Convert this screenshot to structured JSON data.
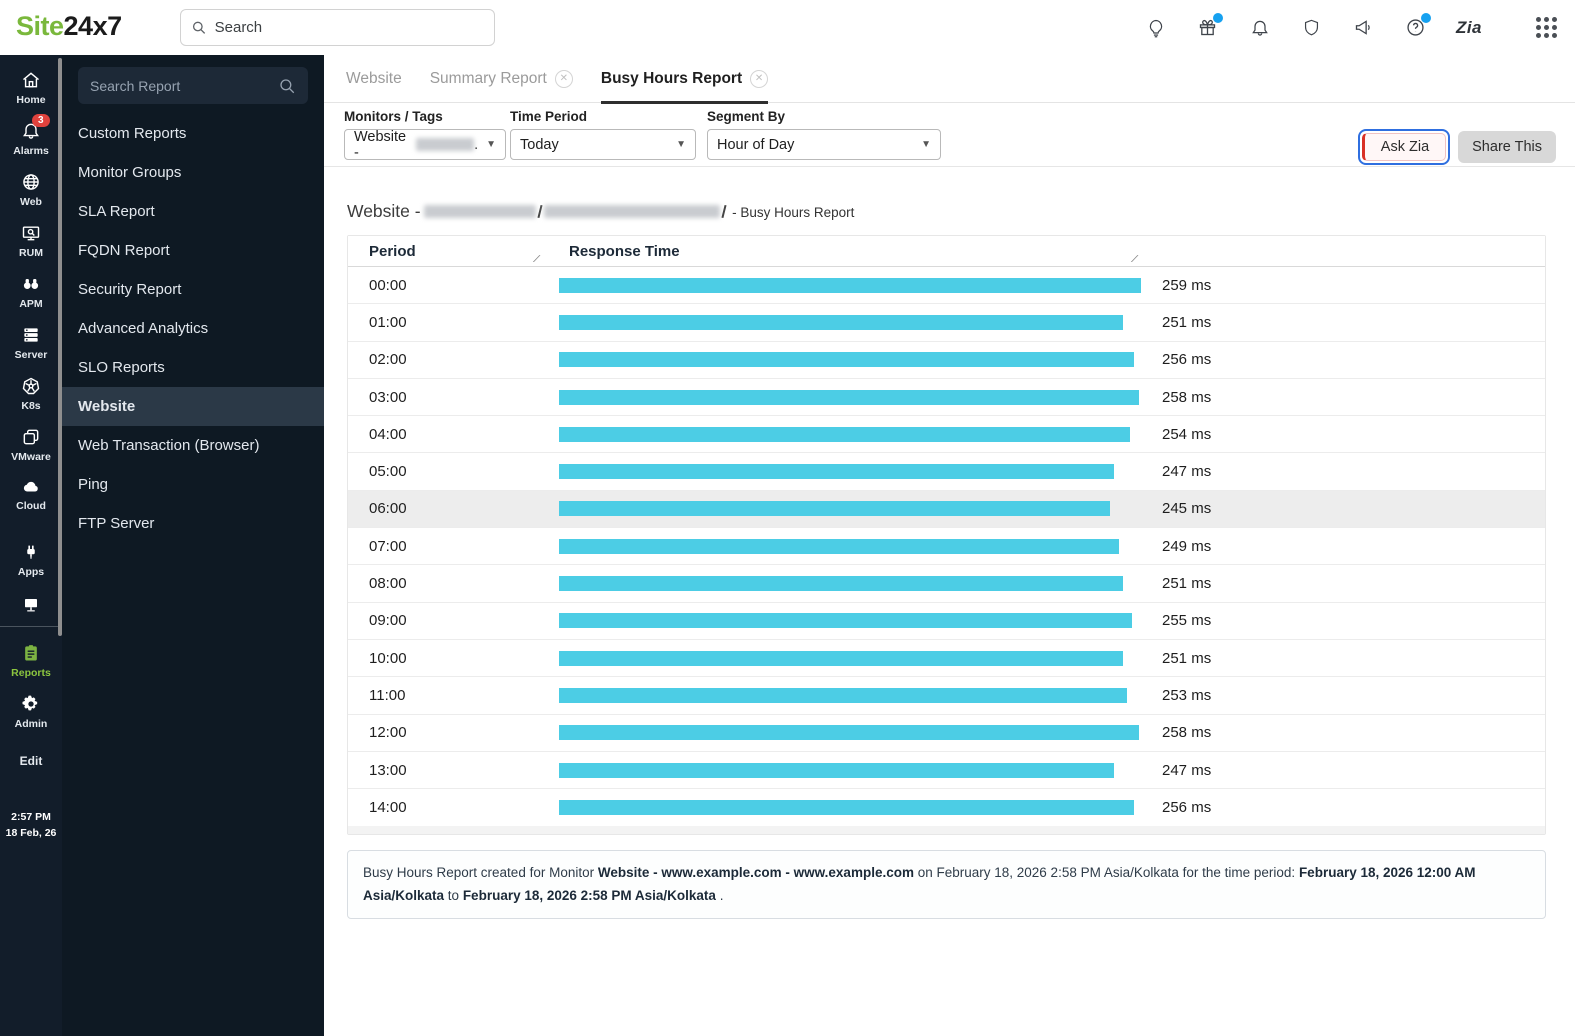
{
  "topbar": {
    "logo": {
      "part1": "Site",
      "part2": "24x7"
    },
    "search_placeholder": "Search",
    "zia_label": "Zia",
    "badges": {
      "gift": true,
      "help": true
    }
  },
  "sidebar": {
    "items": [
      {
        "label": "Home"
      },
      {
        "label": "Alarms",
        "badge": "3"
      },
      {
        "label": "Web"
      },
      {
        "label": "RUM"
      },
      {
        "label": "APM"
      },
      {
        "label": "Server"
      },
      {
        "label": "K8s"
      },
      {
        "label": "VMware"
      },
      {
        "label": "Cloud"
      },
      {
        "label": "Apps"
      },
      {
        "label": ""
      }
    ],
    "reports_label": "Reports",
    "admin_label": "Admin",
    "edit_label": "Edit",
    "time": "2:57 PM",
    "date": "18 Feb, 26"
  },
  "panel": {
    "search_placeholder": "Search Report",
    "items": [
      {
        "label": "Custom Reports",
        "active": false
      },
      {
        "label": "Monitor Groups",
        "active": false
      },
      {
        "label": "SLA Report",
        "active": false
      },
      {
        "label": "FQDN Report",
        "active": false
      },
      {
        "label": "Security Report",
        "active": false
      },
      {
        "label": "Advanced Analytics",
        "active": false
      },
      {
        "label": "SLO Reports",
        "active": false
      },
      {
        "label": "Website",
        "active": true
      },
      {
        "label": "Web Transaction (Browser)",
        "active": false
      },
      {
        "label": "Ping",
        "active": false
      },
      {
        "label": "FTP Server",
        "active": false
      }
    ]
  },
  "tabs": [
    {
      "label": "Website",
      "closable": false,
      "active": false
    },
    {
      "label": "Summary Report",
      "closable": true,
      "active": false
    },
    {
      "label": "Busy Hours Report",
      "closable": true,
      "active": true
    }
  ],
  "filters": {
    "monitors_tags": {
      "label": "Monitors / Tags",
      "value_prefix": "Website -",
      "value_suffix": "."
    },
    "time_period": {
      "label": "Time Period",
      "value": "Today"
    },
    "segment_by": {
      "label": "Segment By",
      "value": "Hour of Day"
    }
  },
  "actions": {
    "ask_zia": "Ask Zia",
    "share_this": "Share This"
  },
  "report": {
    "title_prefix": "Website -",
    "title_suffix": "- Busy Hours Report"
  },
  "table": {
    "headers": [
      "Period",
      "Response Time"
    ],
    "highlight_index": 6,
    "rows": [
      {
        "period": "00:00",
        "ms": 259,
        "label": "259 ms"
      },
      {
        "period": "01:00",
        "ms": 251,
        "label": "251 ms"
      },
      {
        "period": "02:00",
        "ms": 256,
        "label": "256 ms"
      },
      {
        "period": "03:00",
        "ms": 258,
        "label": "258 ms"
      },
      {
        "period": "04:00",
        "ms": 254,
        "label": "254 ms"
      },
      {
        "period": "05:00",
        "ms": 247,
        "label": "247 ms"
      },
      {
        "period": "06:00",
        "ms": 245,
        "label": "245 ms"
      },
      {
        "period": "07:00",
        "ms": 249,
        "label": "249 ms"
      },
      {
        "period": "08:00",
        "ms": 251,
        "label": "251 ms"
      },
      {
        "period": "09:00",
        "ms": 255,
        "label": "255 ms"
      },
      {
        "period": "10:00",
        "ms": 251,
        "label": "251 ms"
      },
      {
        "period": "11:00",
        "ms": 253,
        "label": "253 ms"
      },
      {
        "period": "12:00",
        "ms": 258,
        "label": "258 ms"
      },
      {
        "period": "13:00",
        "ms": 247,
        "label": "247 ms"
      },
      {
        "period": "14:00",
        "ms": 256,
        "label": "256 ms"
      }
    ]
  },
  "chart_data": {
    "type": "bar",
    "orientation": "horizontal",
    "title": "Website - Busy Hours Report",
    "xlabel": "Response Time",
    "ylabel": "Period",
    "categories": [
      "00:00",
      "01:00",
      "02:00",
      "03:00",
      "04:00",
      "05:00",
      "06:00",
      "07:00",
      "08:00",
      "09:00",
      "10:00",
      "11:00",
      "12:00",
      "13:00",
      "14:00"
    ],
    "values": [
      259,
      251,
      256,
      258,
      254,
      247,
      245,
      249,
      251,
      255,
      251,
      253,
      258,
      247,
      256
    ],
    "unit": "ms",
    "xlim": [
      0,
      259
    ],
    "bar_color": "#4ccde5",
    "grid": false,
    "legend": false
  },
  "footer": {
    "segments": [
      {
        "text": "Busy Hours Report created for Monitor ",
        "bold": false
      },
      {
        "text": "Website - www.example.com - www.example.com",
        "bold": true
      },
      {
        "text": " on February 18, 2026 2:58 PM Asia/Kolkata for the time period: ",
        "bold": false
      },
      {
        "text": "February 18, 2026 12:00 AM Asia/Kolkata",
        "bold": true
      },
      {
        "text": " to ",
        "bold": false
      },
      {
        "text": "February 18, 2026 2:58 PM Asia/Kolkata",
        "bold": true
      },
      {
        "text": " .",
        "bold": false
      }
    ]
  }
}
